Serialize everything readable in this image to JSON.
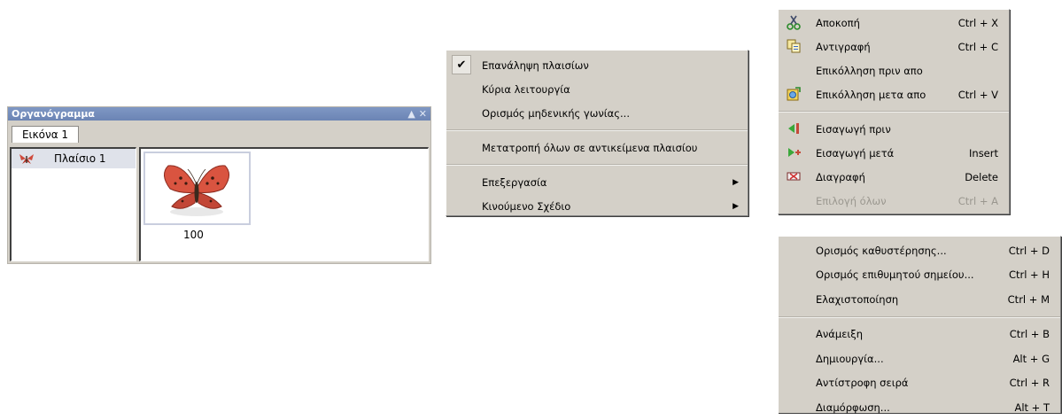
{
  "panel": {
    "title": "Οργανόγραμμα",
    "tab_label": "Εικόνα 1",
    "frames": [
      {
        "label": "Πλαίσιο 1"
      }
    ],
    "thumbnail_caption": "100"
  },
  "context_menu": {
    "items": [
      {
        "label": "Επανάληψη πλαισίων",
        "checked": true
      },
      {
        "label": "Κύρια λειτουργία"
      },
      {
        "label": "Ορισμός μηδενικής γωνίας..."
      },
      {
        "label": "Μετατροπή όλων σε αντικείμενα πλαισίου"
      },
      {
        "label": "Επεξεργασία",
        "submenu": true
      },
      {
        "label": "Κινούμενο Σχέδιο",
        "submenu": true
      }
    ]
  },
  "edit_menu": {
    "items": [
      {
        "label": "Αποκοπή",
        "shortcut": "Ctrl + X",
        "icon": "scissors-icon"
      },
      {
        "label": "Αντιγραφή",
        "shortcut": "Ctrl + C",
        "icon": "copy-icon"
      },
      {
        "label": "Επικόλληση πριν απο",
        "shortcut": ""
      },
      {
        "label": "Επικόλληση μετα απο",
        "shortcut": "Ctrl + V",
        "icon": "paste-after-icon"
      },
      {
        "label": "Εισαγωγή πριν",
        "shortcut": "",
        "icon": "insert-before-icon"
      },
      {
        "label": "Εισαγωγή μετά",
        "shortcut": "Insert",
        "icon": "insert-after-icon"
      },
      {
        "label": "Διαγραφή",
        "shortcut": "Delete",
        "icon": "delete-icon"
      },
      {
        "label": "Επιλογή όλων",
        "shortcut": "Ctrl + A",
        "disabled": true
      }
    ]
  },
  "animation_menu": {
    "items": [
      {
        "label": "Ορισμός καθυστέρησης...",
        "shortcut": "Ctrl + D"
      },
      {
        "label": "Ορισμός επιθυμητού σημείου...",
        "shortcut": "Ctrl + H"
      },
      {
        "label": "Ελαχιστοποίηση",
        "shortcut": "Ctrl + M"
      },
      {
        "label": "Ανάμειξη",
        "shortcut": "Ctrl + B"
      },
      {
        "label": "Δημιουργία...",
        "shortcut": "Alt + G"
      },
      {
        "label": "Αντίστροφη σειρά",
        "shortcut": "Ctrl + R"
      },
      {
        "label": "Διαμόρφωση...",
        "shortcut": "Alt + T"
      }
    ]
  },
  "colors": {
    "menu_bg": "#d4d0c8",
    "title_bar": "#7f98c4",
    "selected_frame_bg": "#dfe2ea"
  }
}
